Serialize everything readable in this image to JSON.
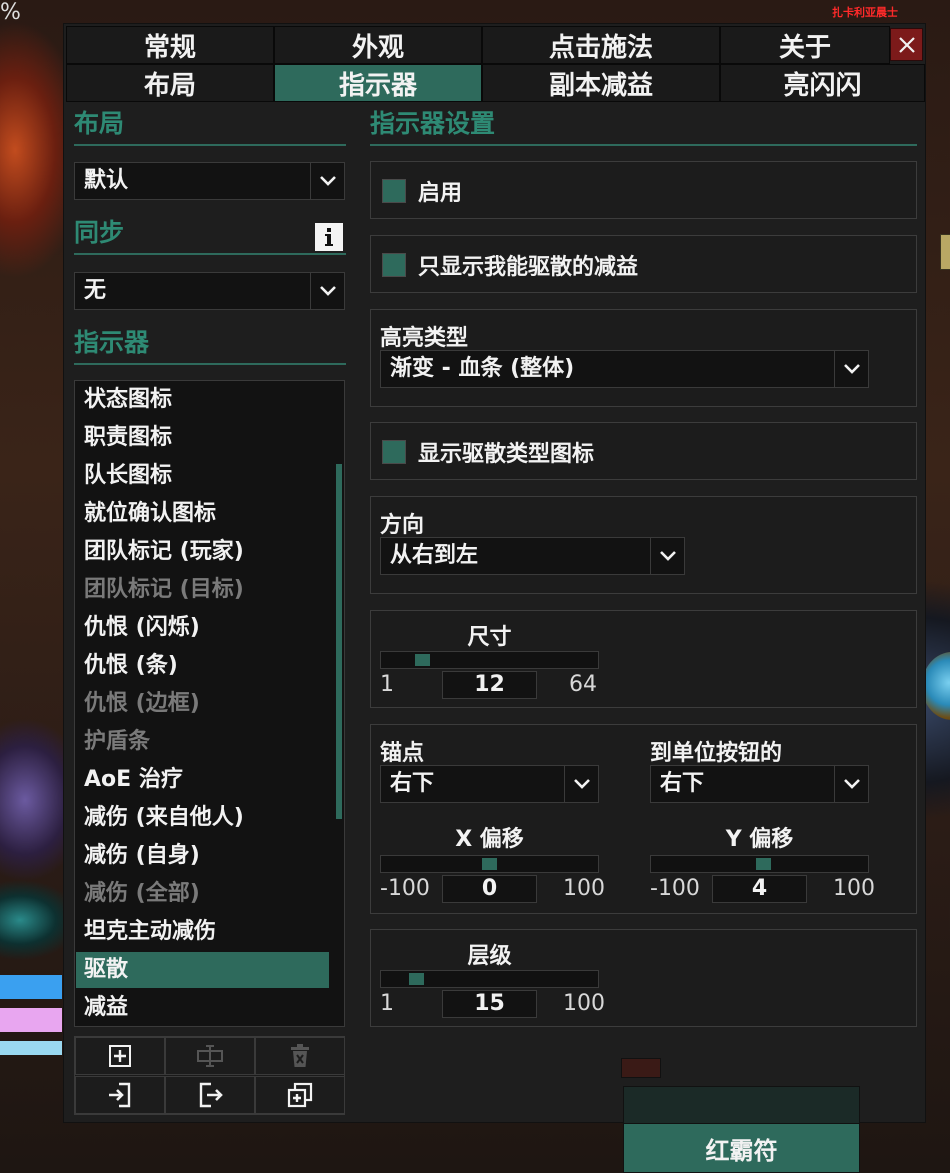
{
  "background": {
    "corner_text": "%",
    "player_name": "扎卡利亚晨士"
  },
  "tabs_row1": [
    "常规",
    "外观",
    "点击施法",
    "关于"
  ],
  "tabs_row2": [
    "布局",
    "指示器",
    "副本减益",
    "亮闪闪"
  ],
  "active_tab": "指示器",
  "left": {
    "layout_title": "布局",
    "layout_value": "默认",
    "sync_title": "同步",
    "sync_value": "无",
    "indicators_title": "指示器",
    "items": [
      {
        "label": "状态图标",
        "state": "normal"
      },
      {
        "label": "职责图标",
        "state": "normal"
      },
      {
        "label": "队长图标",
        "state": "normal"
      },
      {
        "label": "就位确认图标",
        "state": "normal"
      },
      {
        "label": "团队标记 (玩家)",
        "state": "normal"
      },
      {
        "label": "团队标记 (目标)",
        "state": "disabled"
      },
      {
        "label": "仇恨 (闪烁)",
        "state": "normal"
      },
      {
        "label": "仇恨 (条)",
        "state": "normal"
      },
      {
        "label": "仇恨 (边框)",
        "state": "disabled"
      },
      {
        "label": "护盾条",
        "state": "disabled"
      },
      {
        "label": "AoE 治疗",
        "state": "normal"
      },
      {
        "label": "减伤 (来自他人)",
        "state": "normal"
      },
      {
        "label": "减伤 (自身)",
        "state": "normal"
      },
      {
        "label": "减伤 (全部)",
        "state": "disabled"
      },
      {
        "label": "坦克主动减伤",
        "state": "normal"
      },
      {
        "label": "驱散",
        "state": "selected"
      },
      {
        "label": "减益",
        "state": "normal"
      }
    ]
  },
  "right": {
    "title": "指示器设置",
    "enable_label": "启用",
    "dispellable_only_label": "只显示我能驱散的减益",
    "highlight_type_label": "高亮类型",
    "highlight_type_value": "渐变 - 血条 (整体)",
    "show_dispel_icon_label": "显示驱散类型图标",
    "direction_label": "方向",
    "direction_value": "从右到左",
    "size": {
      "label": "尺寸",
      "min": "1",
      "value": "12",
      "max": "64",
      "fraction": 0.17
    },
    "anchor_label": "锚点",
    "anchor_value": "右下",
    "relative_label": "到单位按钮的",
    "relative_value": "右下",
    "x_offset": {
      "label": "X 偏移",
      "min": "-100",
      "value": "0",
      "max": "100",
      "fraction": 0.5
    },
    "y_offset": {
      "label": "Y 偏移",
      "min": "-100",
      "value": "4",
      "max": "100",
      "fraction": 0.52
    },
    "frame_level": {
      "label": "层级",
      "min": "1",
      "value": "15",
      "max": "100",
      "fraction": 0.14
    }
  },
  "bottom_button": "红霸符"
}
